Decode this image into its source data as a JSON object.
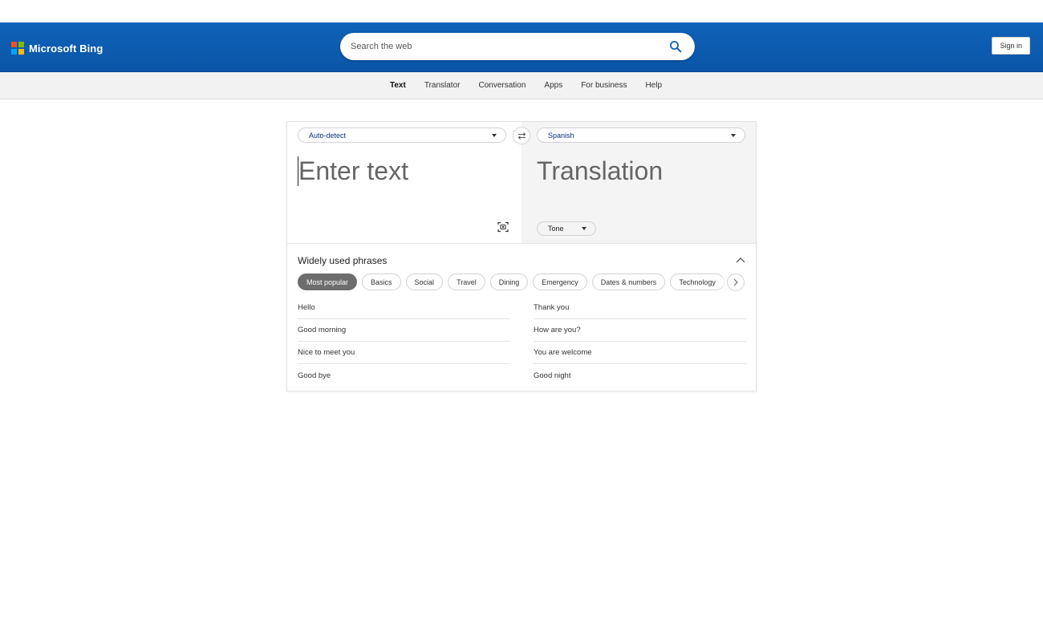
{
  "header": {
    "brand": "Microsoft Bing",
    "search_placeholder": "Search the web",
    "signin_label": "Sign in",
    "colors": {
      "bar": "#0f63b9",
      "ms_red": "#f25022",
      "ms_green": "#7fba00",
      "ms_blue": "#00a4ef",
      "ms_yellow": "#ffb900"
    }
  },
  "subnav": {
    "items": [
      {
        "label": "Text",
        "active": true
      },
      {
        "label": "Translator",
        "active": false
      },
      {
        "label": "Conversation",
        "active": false
      },
      {
        "label": "Apps",
        "active": false
      },
      {
        "label": "For business",
        "active": false
      },
      {
        "label": "Help",
        "active": false
      }
    ]
  },
  "translator": {
    "source_lang": "Auto-detect",
    "target_lang": "Spanish",
    "source_placeholder": "Enter text",
    "target_placeholder": "Translation",
    "tone_label": "Tone",
    "swap_icon": "swap-arrows-icon",
    "camera_icon": "camera-scan-icon"
  },
  "phrases": {
    "title": "Widely used phrases",
    "categories": [
      {
        "label": "Most popular",
        "active": true
      },
      {
        "label": "Basics",
        "active": false
      },
      {
        "label": "Social",
        "active": false
      },
      {
        "label": "Travel",
        "active": false
      },
      {
        "label": "Dining",
        "active": false
      },
      {
        "label": "Emergency",
        "active": false
      },
      {
        "label": "Dates & numbers",
        "active": false
      },
      {
        "label": "Technology",
        "active": false
      }
    ],
    "left": [
      "Hello",
      "Good morning",
      "Nice to meet you",
      "Good bye"
    ],
    "right": [
      "Thank you",
      "How are you?",
      "You are welcome",
      "Good night"
    ]
  }
}
